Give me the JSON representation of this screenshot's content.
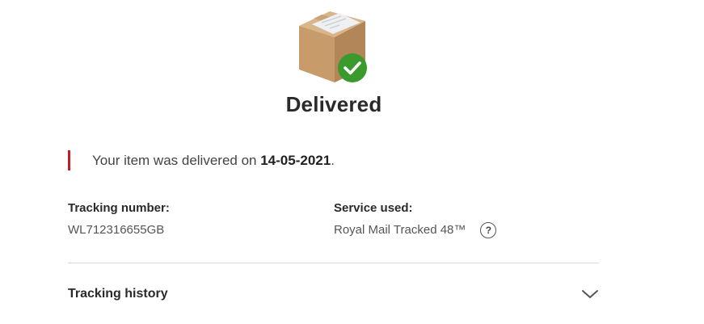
{
  "status": {
    "title": "Delivered",
    "icon": "parcel-delivered-icon",
    "check_color": "#3a9a2d"
  },
  "notice": {
    "prefix": "Your item was delivered on ",
    "date": "14-05-2021",
    "suffix": ".",
    "accent_color": "#c51d23"
  },
  "details": {
    "tracking_number_label": "Tracking number:",
    "tracking_number_value": "WL712316655GB",
    "service_label": "Service used:",
    "service_value": "Royal Mail Tracked 48™",
    "service_help_glyph": "?"
  },
  "history": {
    "label": "Tracking history",
    "icon": "chevron-down-icon"
  }
}
